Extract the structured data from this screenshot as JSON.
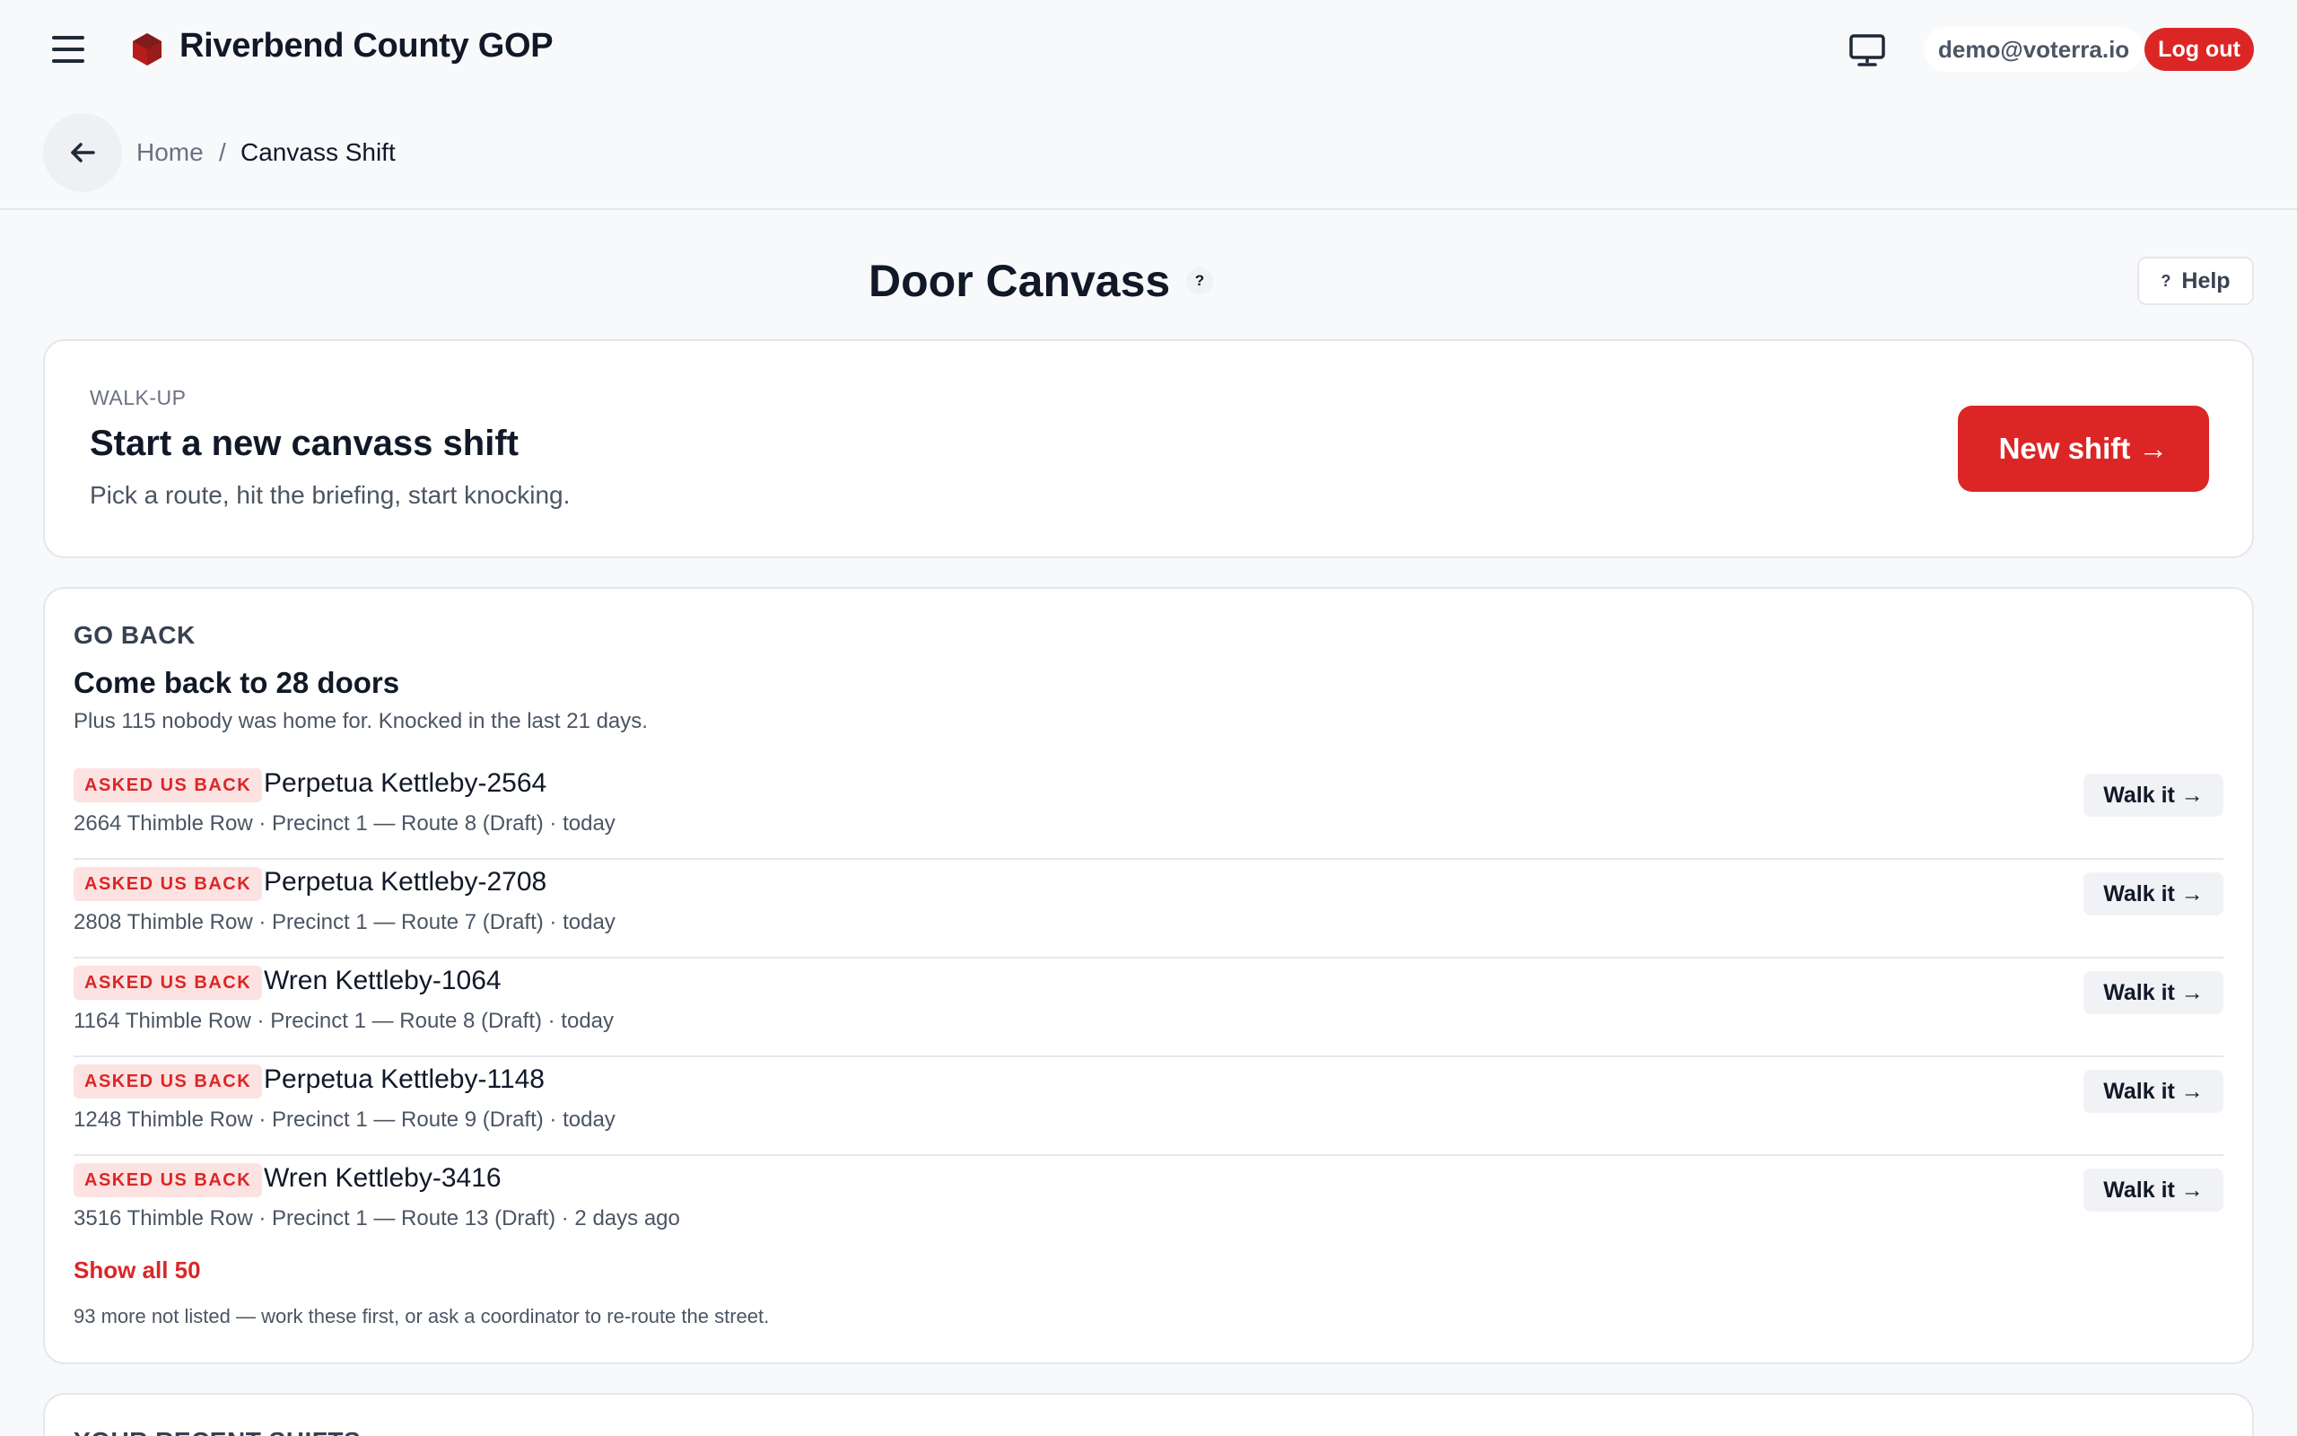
{
  "header": {
    "org_name": "Riverbend County GOP",
    "email": "demo@voterra.io",
    "logout_label": "Log out",
    "logo_color": "#b91c1c",
    "accent_color": "#dc2626"
  },
  "breadcrumb": {
    "home": "Home",
    "separator": "/",
    "current": "Canvass Shift"
  },
  "page": {
    "title": "Door Canvass",
    "title_help_glyph": "?",
    "help_glyph": "?",
    "help_label": "Help"
  },
  "walkup": {
    "eyebrow": "WALK-UP",
    "title": "Start a new canvass shift",
    "subtitle": "Pick a route, hit the briefing, start knocking.",
    "button_label": "New shift →"
  },
  "go_back": {
    "eyebrow": "GO BACK",
    "title": "Come back to 28 doors",
    "subtitle": "Plus 115 nobody was home for. Knocked in the last 21 days.",
    "rows": [
      {
        "badge": "ASKED US BACK",
        "name": "Perpetua Kettleby-2564",
        "meta": "2664 Thimble Row · Precinct 1 — Route 8 (Draft) · today",
        "action": "Walk it →"
      },
      {
        "badge": "ASKED US BACK",
        "name": "Perpetua Kettleby-2708",
        "meta": "2808 Thimble Row · Precinct 1 — Route 7 (Draft) · today",
        "action": "Walk it →"
      },
      {
        "badge": "ASKED US BACK",
        "name": "Wren Kettleby-1064",
        "meta": "1164 Thimble Row · Precinct 1 — Route 8 (Draft) · today",
        "action": "Walk it →"
      },
      {
        "badge": "ASKED US BACK",
        "name": "Perpetua Kettleby-1148",
        "meta": "1248 Thimble Row · Precinct 1 — Route 9 (Draft) · today",
        "action": "Walk it →"
      },
      {
        "badge": "ASKED US BACK",
        "name": "Wren Kettleby-3416",
        "meta": "3516 Thimble Row · Precinct 1 — Route 13 (Draft) · 2 days ago",
        "action": "Walk it →"
      }
    ],
    "show_all_label": "Show all 50",
    "footnote": "93 more not listed — work these first, or ask a coordinator to re-route the street."
  },
  "recent": {
    "eyebrow": "YOUR RECENT SHIFTS"
  }
}
